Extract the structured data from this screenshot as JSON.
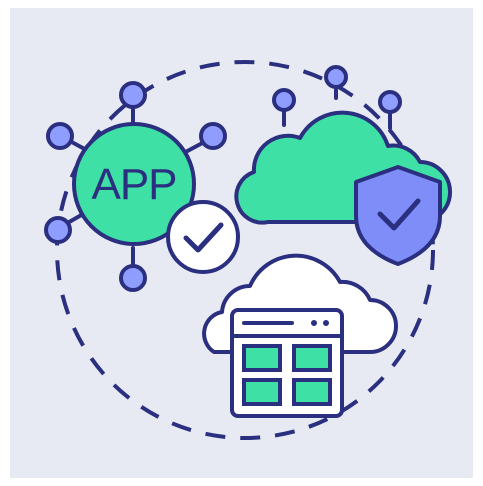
{
  "illustration": {
    "app_badge_text": "APP",
    "icons": {
      "app_hub": "app-network-icon",
      "app_check": "checkmark-icon",
      "cloud": "cloud-icon",
      "shield": "shield-check-icon",
      "browser_cloud": "cloud-browser-icon"
    },
    "colors": {
      "background": "#e7eaf3",
      "outline": "#2b2f7f",
      "mint": "#3fe0a6",
      "node": "#8f9dff",
      "shield": "#7f8df9",
      "white": "#ffffff"
    }
  }
}
